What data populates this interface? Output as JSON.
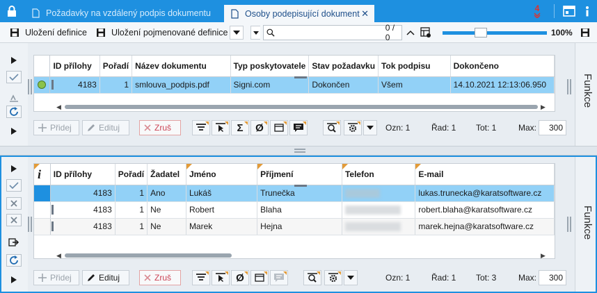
{
  "tabs": [
    {
      "label": "Požadavky na vzdálený podpis dokumentu",
      "active": false
    },
    {
      "label": "Osoby podepisující dokument",
      "active": true
    }
  ],
  "titlebar": {
    "badge": "4"
  },
  "toolbar": {
    "save_definition": "Uložení definice",
    "save_named_definition": "Uložení pojmenované definice",
    "search_value": "",
    "search_count": "0 / 0",
    "zoom": "100%",
    "zoom_level_pct": 35
  },
  "top_grid": {
    "columns": [
      "ID přílohy",
      "Pořadí",
      "Název dokumentu",
      "Typ poskytovatele",
      "Stav požadavku",
      "Tok podpisu",
      "Dokončeno"
    ],
    "rows": [
      [
        "4183",
        "1",
        "smlouva_podpis.pdf",
        "Signi.com",
        "Dokončen",
        "Všem",
        "14.10.2021 12:13:06.950"
      ]
    ]
  },
  "top_actions": {
    "add": "Přidej",
    "edit": "Edituj",
    "cancel": "Zruš",
    "ozn": "Ozn: 1",
    "rad": "Řad: 1",
    "tot": "Tot:  1",
    "max_label": "Max:",
    "max_value": "300"
  },
  "bottom_grid": {
    "info_label": "i",
    "columns": [
      "ID přílohy",
      "Pořadí",
      "Žadatel",
      "Jméno",
      "Příjmení",
      "Telefon",
      "E-mail"
    ],
    "rows": [
      [
        "4183",
        "1",
        "Ano",
        "Lukáš",
        "Trunečka",
        "",
        "lukas.trunecka@karatsoftware.cz"
      ],
      [
        "4183",
        "1",
        "Ne",
        "Robert",
        "Blaha",
        "",
        "robert.blaha@karatsoftware.cz"
      ],
      [
        "4183",
        "1",
        "Ne",
        "Marek",
        "Hejna",
        "",
        "marek.hejna@karatsoftware.cz"
      ]
    ]
  },
  "bottom_actions": {
    "add": "Přidej",
    "edit": "Edituj",
    "cancel": "Zruš",
    "ozn": "Ozn: 1",
    "rad": "Řad: 1",
    "tot": "Tot:  3",
    "max_label": "Max:",
    "max_value": "300"
  },
  "side_panel": {
    "label": "Funkce"
  },
  "colors": {
    "accent": "#1e90e0",
    "selected_row": "#92d1f7",
    "orange_marker": "#e39b38",
    "badge_red": "#e0322b"
  }
}
